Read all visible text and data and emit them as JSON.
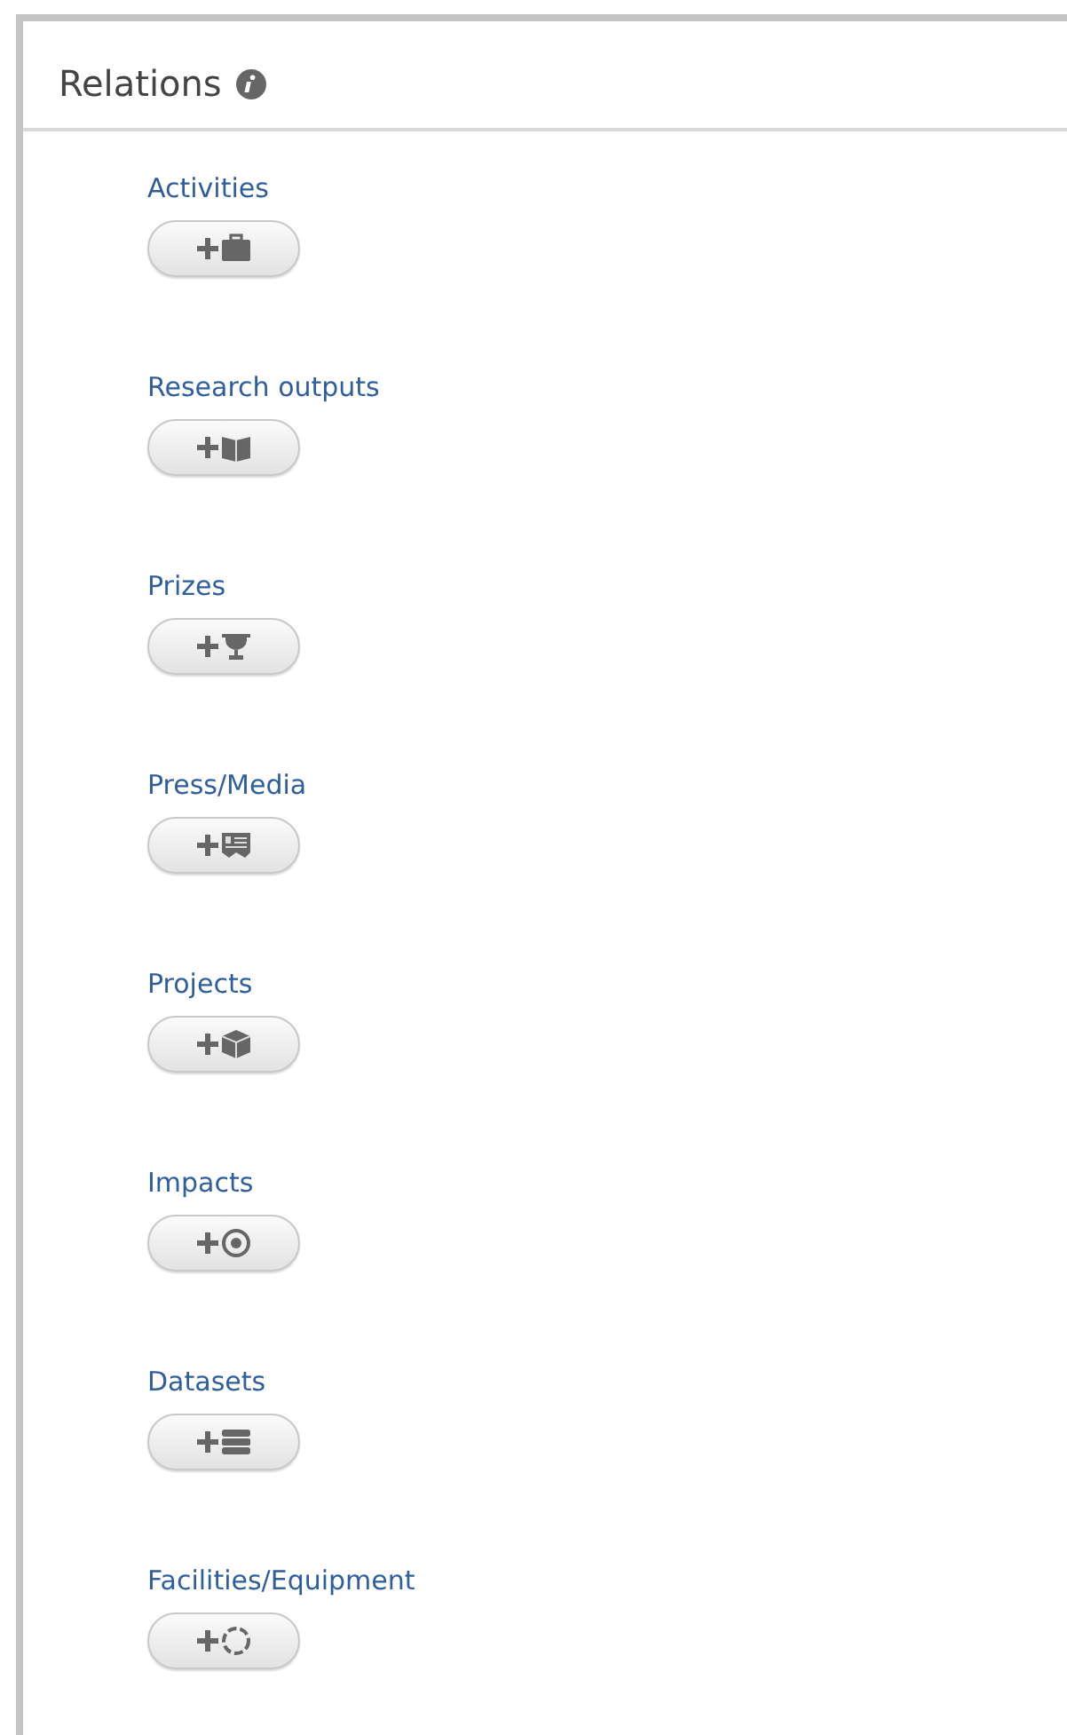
{
  "panel": {
    "title": "Relations"
  },
  "relations": [
    {
      "label": "Activities"
    },
    {
      "label": "Research outputs"
    },
    {
      "label": "Prizes"
    },
    {
      "label": "Press/Media"
    },
    {
      "label": "Projects"
    },
    {
      "label": "Impacts"
    },
    {
      "label": "Datasets"
    },
    {
      "label": "Facilities/Equipment"
    }
  ]
}
